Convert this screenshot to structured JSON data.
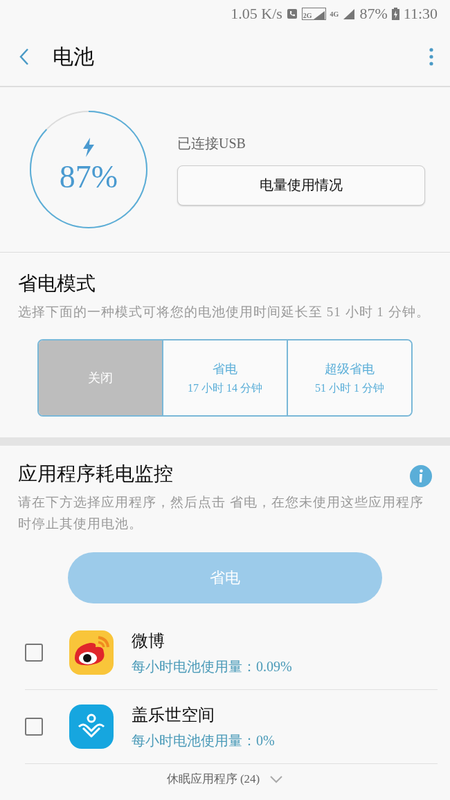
{
  "status_bar": {
    "speed": "1.05 K/s",
    "network_2g": "2G",
    "network_4g": "4G",
    "battery": "87%",
    "time": "11:30"
  },
  "header": {
    "title": "电池"
  },
  "battery": {
    "percent": "87%",
    "charging": true,
    "status": "已连接USB",
    "usage_button": "电量使用情况"
  },
  "power_saving": {
    "title": "省电模式",
    "description": "选择下面的一种模式可将您的电池使用时间延长至 51 小时 1 分钟。",
    "modes": [
      {
        "label": "关闭",
        "selected": true
      },
      {
        "label": "省电",
        "duration": "17 小时 14 分钟",
        "selected": false
      },
      {
        "label": "超级省电",
        "duration": "51 小时 1 分钟",
        "selected": false
      }
    ]
  },
  "app_monitor": {
    "title": "应用程序耗电监控",
    "description": "请在下方选择应用程序，然后点击 省电，在您未使用这些应用程序时停止其使用电池。",
    "button": "省电",
    "button_disabled": true,
    "apps": [
      {
        "kind": "weibo",
        "name": "微博",
        "usage": "每小时电池使用量：0.09%",
        "checked": false
      },
      {
        "kind": "space",
        "name": "盖乐世空间",
        "usage": "每小时电池使用量：0%",
        "checked": false
      }
    ],
    "sleeping": "休眠应用程序 (24)"
  }
}
